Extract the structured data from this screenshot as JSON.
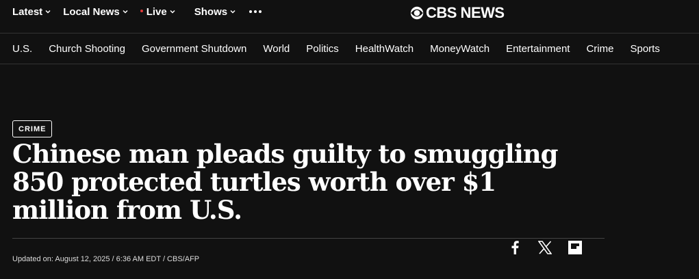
{
  "topnav": {
    "items": [
      {
        "label": "Latest"
      },
      {
        "label": "Local News"
      },
      {
        "label": "Live"
      },
      {
        "label": "Shows"
      }
    ]
  },
  "logo": {
    "text": "CBS NEWS"
  },
  "sections": [
    "U.S.",
    "Church Shooting",
    "Government Shutdown",
    "World",
    "Politics",
    "HealthWatch",
    "MoneyWatch",
    "Entertainment",
    "Crime",
    "Sports"
  ],
  "article": {
    "category": "CRIME",
    "headline": "Chinese man pleads guilty to smuggling 850 protected turtles worth over $1 million from U.S.",
    "byline": "Updated on: August 12, 2025 / 6:36 AM EDT / CBS/AFP"
  },
  "share": {
    "icons": [
      "facebook-icon",
      "x-icon",
      "flipboard-icon"
    ]
  },
  "colors": {
    "background": "#111111",
    "live_dot": "#e03a3a",
    "text": "#ffffff"
  }
}
